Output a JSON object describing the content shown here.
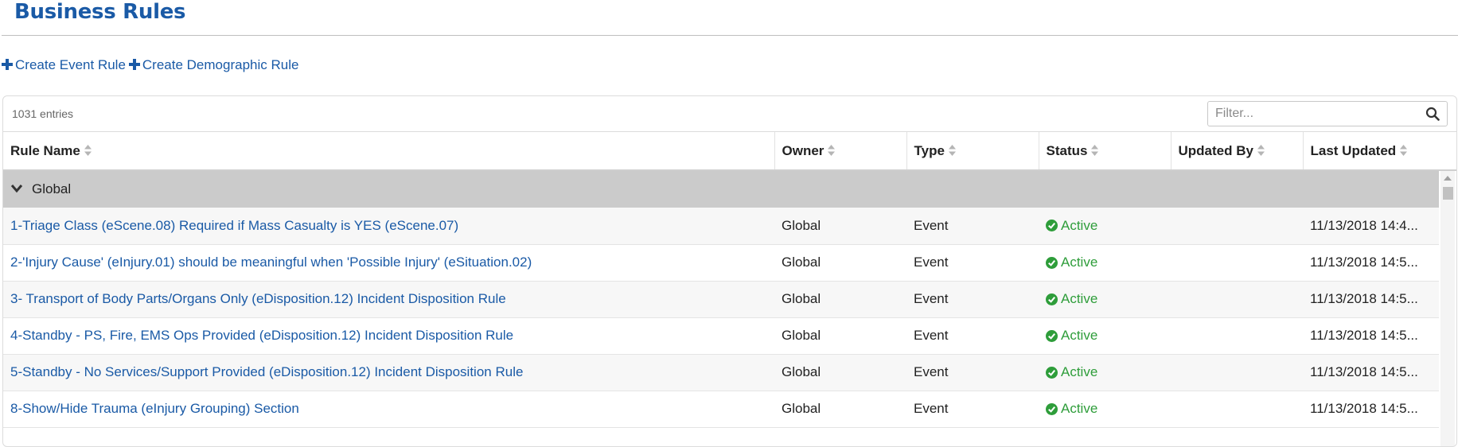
{
  "page": {
    "title": "Business Rules"
  },
  "actions": {
    "create_event_rule": "Create Event Rule",
    "create_demographic_rule": "Create Demographic Rule"
  },
  "table": {
    "entries_count": "1031 entries",
    "filter_placeholder": "Filter...",
    "columns": [
      "Rule Name",
      "Owner",
      "Type",
      "Status",
      "Updated By",
      "Last Updated"
    ],
    "group": {
      "label": "Global"
    },
    "rows": [
      {
        "name": "1-Triage Class (eScene.08) Required if Mass Casualty is YES (eScene.07)",
        "owner": "Global",
        "type": "Event",
        "status": "Active",
        "updated_by": "",
        "last_updated": "11/13/2018 14:4..."
      },
      {
        "name": "2-'Injury Cause' (eInjury.01) should be meaningful when 'Possible Injury' (eSituation.02)",
        "owner": "Global",
        "type": "Event",
        "status": "Active",
        "updated_by": "",
        "last_updated": "11/13/2018 14:5..."
      },
      {
        "name": "3- Transport of Body Parts/Organs Only (eDisposition.12) Incident Disposition Rule",
        "owner": "Global",
        "type": "Event",
        "status": "Active",
        "updated_by": "",
        "last_updated": "11/13/2018 14:5..."
      },
      {
        "name": "4-Standby - PS, Fire, EMS Ops Provided (eDisposition.12) Incident Disposition Rule",
        "owner": "Global",
        "type": "Event",
        "status": "Active",
        "updated_by": "",
        "last_updated": "11/13/2018 14:5..."
      },
      {
        "name": "5-Standby - No Services/Support Provided (eDisposition.12) Incident Disposition Rule",
        "owner": "Global",
        "type": "Event",
        "status": "Active",
        "updated_by": "",
        "last_updated": "11/13/2018 14:5..."
      },
      {
        "name": "8-Show/Hide Trauma (eInjury Grouping) Section",
        "owner": "Global",
        "type": "Event",
        "status": "Active",
        "updated_by": "",
        "last_updated": "11/13/2018 14:5..."
      }
    ]
  },
  "colors": {
    "link": "#1a5aa6",
    "active": "#2e9d3a",
    "group_bg": "#cbcbcb"
  },
  "icons": {
    "create": "plus-icon",
    "search": "search-icon",
    "sort": "sort-icon",
    "group_toggle": "chevron-down-icon",
    "status": "check-circle-icon"
  }
}
